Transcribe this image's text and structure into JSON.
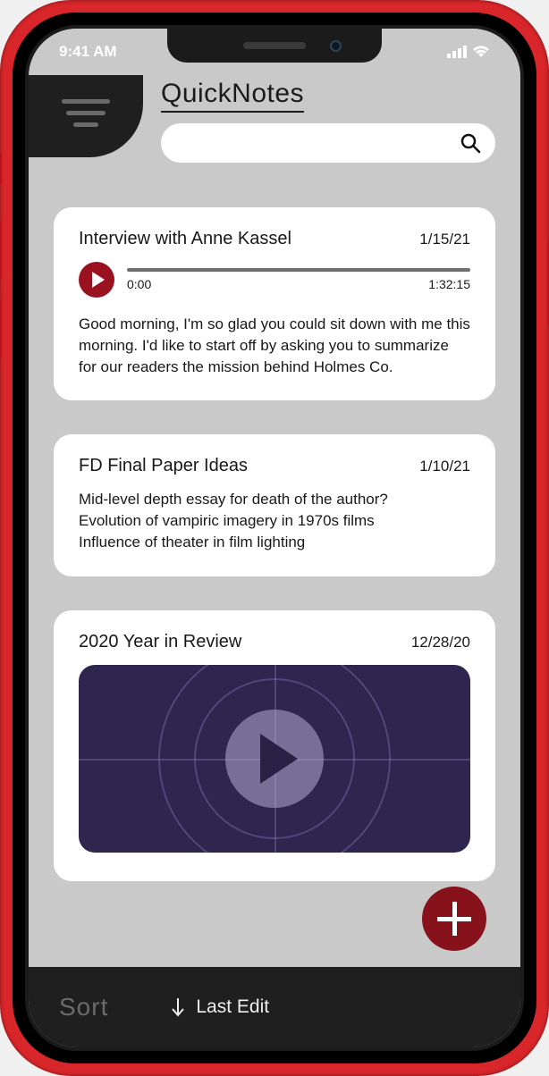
{
  "status": {
    "time": "9:41 AM"
  },
  "header": {
    "title": "QuickNotes"
  },
  "search": {
    "placeholder": ""
  },
  "notes": [
    {
      "title": "Interview with Anne Kassel",
      "date": "1/15/21",
      "audio": {
        "start": "0:00",
        "end": "1:32:15"
      },
      "body": "Good morning, I'm so glad you could sit down with me this morning.  I'd like to start off by asking you to summarize for our readers the mission behind Holmes Co."
    },
    {
      "title": "FD Final Paper Ideas",
      "date": "1/10/21",
      "body": "Mid-level depth essay for death of the author?\nEvolution of vampiric imagery in 1970s films\nInfluence of theater in film lighting"
    },
    {
      "title": "2020 Year in Review",
      "date": "12/28/20"
    }
  ],
  "bottomBar": {
    "sort_label": "Sort",
    "sort_value": "Last Edit"
  }
}
